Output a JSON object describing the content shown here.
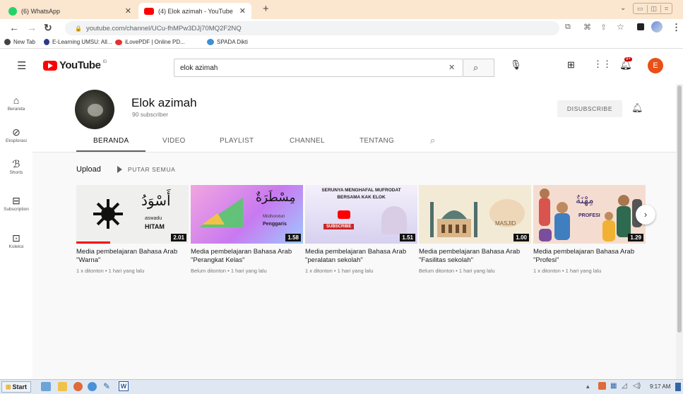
{
  "browser": {
    "tabs": [
      {
        "label": "(6) WhatsApp",
        "active": false
      },
      {
        "label": "(4) Elok azimah - YouTube",
        "active": true
      }
    ],
    "new_tab_label": "+",
    "url": "youtube.com/channel/UCu-fhMPw3DJj70MQ2F2NQ",
    "bookmarks": [
      "New Tab",
      "E-Learning UMSU: All...",
      "iLovePDF | Online PD...",
      "SPADA Dikti"
    ]
  },
  "youtube": {
    "logo_text": "YouTube",
    "logo_region": "ID",
    "search_value": "elok azimah",
    "avatar_letter": "E",
    "notification_count": "9+"
  },
  "sidebar": {
    "items": [
      {
        "label": "Beranda",
        "icon": "home-icon"
      },
      {
        "label": "Eksplorasi",
        "icon": "explore-icon"
      },
      {
        "label": "Shorts",
        "icon": "shorts-icon"
      },
      {
        "label": "Subscription",
        "icon": "subscriptions-icon"
      },
      {
        "label": "Koleksi",
        "icon": "library-icon"
      }
    ]
  },
  "channel": {
    "name": "Elok azimah",
    "subscribers": "90 subscriber",
    "subscribe_button": "DISUBSCRIBE",
    "tabs": [
      "BERANDA",
      "VIDEO",
      "PLAYLIST",
      "CHANNEL",
      "TENTANG"
    ],
    "active_tab": "BERANDA"
  },
  "section": {
    "title": "Upload",
    "play_all": "PUTAR SEMUA"
  },
  "videos": [
    {
      "title": "Media pembelajaran Bahasa Arab \"Warna\"",
      "meta": "1 x ditonton • 1 hari yang lalu",
      "duration": "2.01",
      "thumb": {
        "arabic": "أَسْوَدُ",
        "latin1": "aswadu",
        "latin2": "HITAM"
      }
    },
    {
      "title": "Media pembelajaran Bahasa Arab \"Perangkat Kelas\"",
      "meta": "Belum ditonton • 1 hari yang lalu",
      "duration": "1.58",
      "thumb": {
        "arabic": "مِسْطَرَةٌ",
        "latin1": "Misthorotun",
        "latin2": "Penggaris"
      }
    },
    {
      "title": "Media pembelajaran Bahasa Arab \"peralatan sekolah\"",
      "meta": "1 x ditonton • 1 hari yang lalu",
      "duration": "1.51",
      "thumb": {
        "line1": "SERUNYA MENGHAFAL MUFRODAT",
        "line2": "BERSAMA KAK ELOK",
        "button": "SUBSCRIBE"
      }
    },
    {
      "title": "Media pembelajaran Bahasa Arab \"Fasilitas sekolah\"",
      "meta": "Belum ditonton • 1 hari yang lalu",
      "duration": "1.00",
      "thumb": {
        "latin1": "MASJID"
      }
    },
    {
      "title": "Media pembelajaran Bahasa Arab \"Profesi\"",
      "meta": "1 x ditonton • 1 hari yang lalu",
      "duration": "1.29",
      "thumb": {
        "arabic": "مِهْنَةٌ",
        "latin1": "PROFESI"
      }
    }
  ],
  "taskbar": {
    "start_label": "Start",
    "time": "9:17 AM"
  },
  "colors": {
    "brand_red": "#ff0000",
    "accent_orange": "#e8501a",
    "tab_strip": "#fbe6cf"
  }
}
